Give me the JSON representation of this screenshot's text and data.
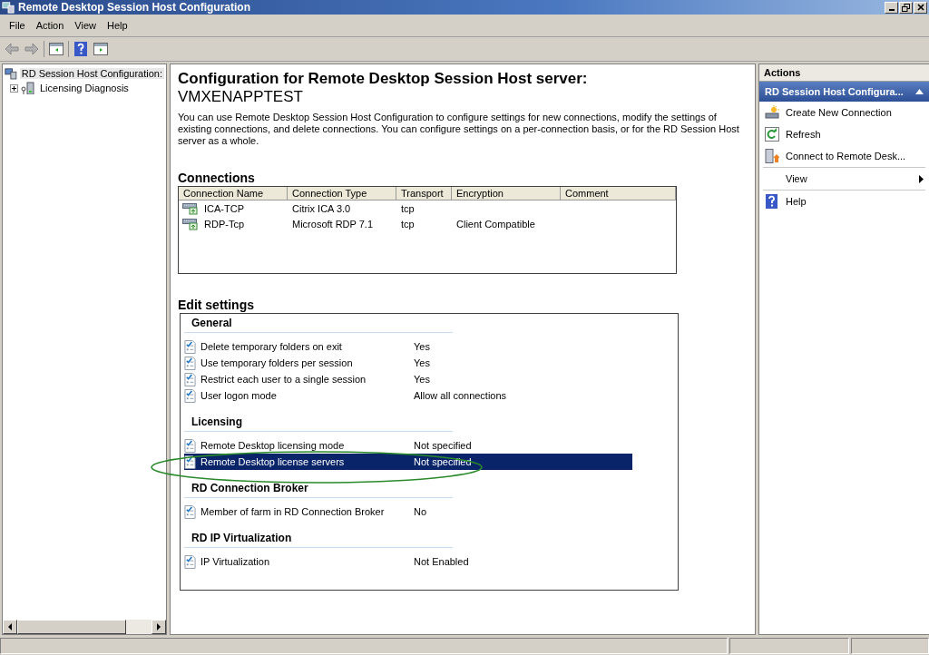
{
  "window": {
    "title": "Remote Desktop Session Host Configuration"
  },
  "menu": [
    "File",
    "Action",
    "View",
    "Help"
  ],
  "tree": [
    {
      "label": "RD Session Host Configuration:",
      "selected": true,
      "children": [
        {
          "label": "Licensing Diagnosis",
          "selected": false,
          "expanded": false
        }
      ]
    }
  ],
  "main": {
    "heading": "Configuration for Remote Desktop Session Host server:",
    "server": "VMXENAPPTEST",
    "description": "You can use Remote Desktop Session Host Configuration to configure settings for new connections, modify the settings of existing connections, and delete connections. You can configure settings on a per-connection basis, or for the RD Session Host server as a whole.",
    "connections": {
      "title": "Connections",
      "columns": [
        "Connection Name",
        "Connection Type",
        "Transport",
        "Encryption",
        "Comment"
      ],
      "rows": [
        {
          "cells": [
            "ICA-TCP",
            "Citrix ICA 3.0",
            "tcp",
            "",
            ""
          ]
        },
        {
          "cells": [
            "RDP-Tcp",
            "Microsoft RDP 7.1",
            "tcp",
            "Client Compatible",
            ""
          ]
        }
      ]
    },
    "edit_settings": {
      "title": "Edit settings",
      "groups": [
        {
          "title": "General",
          "items": [
            {
              "label": "Delete temporary folders on exit",
              "value": "Yes",
              "selected": false
            },
            {
              "label": "Use temporary folders per session",
              "value": "Yes",
              "selected": false
            },
            {
              "label": "Restrict each user to a single session",
              "value": "Yes",
              "selected": false
            },
            {
              "label": "User logon mode",
              "value": "Allow all connections",
              "selected": false
            }
          ]
        },
        {
          "title": "Licensing",
          "items": [
            {
              "label": "Remote Desktop licensing mode",
              "value": "Not specified",
              "selected": false
            },
            {
              "label": "Remote Desktop license servers",
              "value": "Not specified",
              "selected": true
            }
          ]
        },
        {
          "title": "RD Connection Broker",
          "items": [
            {
              "label": "Member of farm in RD Connection Broker",
              "value": "No",
              "selected": false
            }
          ]
        },
        {
          "title": "RD IP Virtualization",
          "items": [
            {
              "label": "IP Virtualization",
              "value": "Not Enabled",
              "selected": false
            }
          ]
        }
      ]
    }
  },
  "actions": {
    "title": "Actions",
    "section": {
      "title": "RD Session Host Configura...",
      "expanded": true
    },
    "items": [
      {
        "label": "Create New Connection",
        "kind": "create"
      },
      {
        "label": "Refresh",
        "kind": "refresh"
      },
      {
        "label": "Connect to Remote Desk...",
        "kind": "connect"
      },
      {
        "label": "View",
        "kind": "submenu"
      },
      {
        "label": "Help",
        "kind": "help"
      }
    ]
  }
}
